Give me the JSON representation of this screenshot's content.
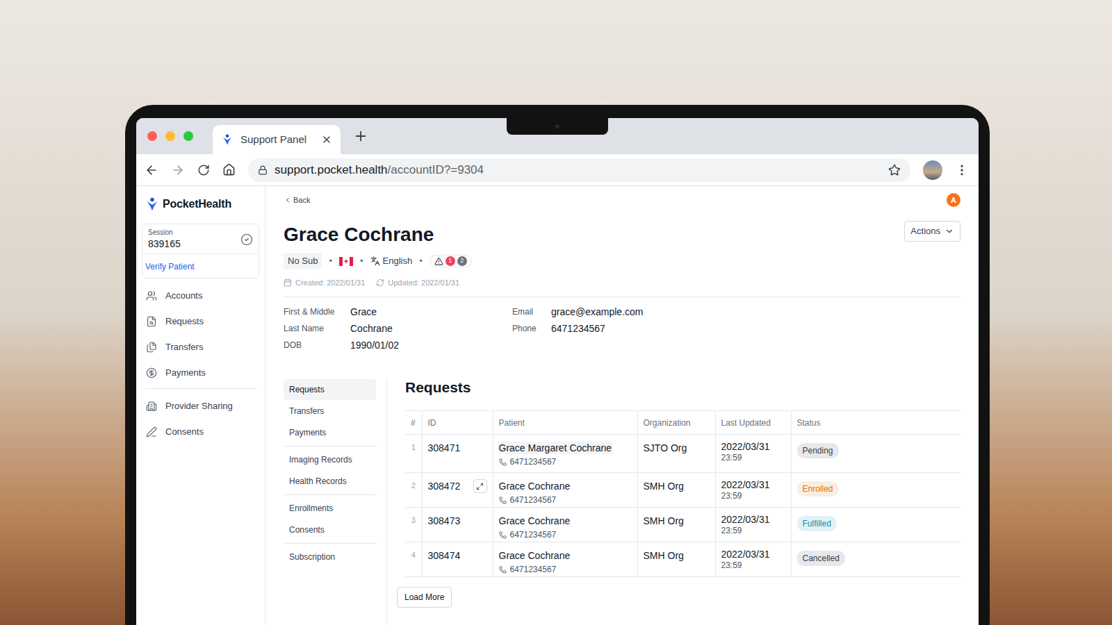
{
  "browser": {
    "tab_title": "Support Panel",
    "url_host": "support.pocket.health",
    "url_path": "/accountID?=9304"
  },
  "app": {
    "logo": "PocketHealth"
  },
  "session": {
    "label": "Session",
    "number": "839165",
    "verified": true,
    "action": "Verify Patient"
  },
  "sidebar": {
    "groups": [
      [
        {
          "label": "Accounts",
          "icon": "accounts",
          "selected": false
        },
        {
          "label": "Requests",
          "icon": "requests",
          "selected": false
        },
        {
          "label": "Transfers",
          "icon": "transfers",
          "selected": false
        },
        {
          "label": "Payments",
          "icon": "payments",
          "selected": false
        }
      ],
      [
        {
          "label": "Provider Sharing",
          "icon": "provider",
          "selected": false
        },
        {
          "label": "Consents",
          "icon": "consents",
          "selected": false
        }
      ]
    ]
  },
  "header": {
    "back": "Back",
    "avatar": "A",
    "name": "Grace Cochrane",
    "actions": "Actions",
    "subscription": "No Sub",
    "language": "English",
    "alerts": [
      {
        "count": "1",
        "color": "#f43f5e"
      },
      {
        "count": "2",
        "color": "#6b7280"
      }
    ],
    "created": "Created: 2022/01/31",
    "updated": "Updated: 2022/01/31"
  },
  "fields": {
    "left": [
      {
        "label": "First & Middle",
        "value": "Grace"
      },
      {
        "label": "Last Name",
        "value": "Cochrane"
      },
      {
        "label": "DOB",
        "value": "1990/01/02"
      }
    ],
    "right": [
      {
        "label": "Email",
        "value": "grace@example.com"
      },
      {
        "label": "Phone",
        "value": "6471234567"
      }
    ]
  },
  "subnav": {
    "groups": [
      [
        {
          "label": "Requests",
          "selected": true
        },
        {
          "label": "Transfers",
          "selected": false
        },
        {
          "label": "Payments",
          "selected": false
        }
      ],
      [
        {
          "label": "Imaging Records",
          "selected": false
        },
        {
          "label": "Health Records",
          "selected": false
        }
      ],
      [
        {
          "label": "Enrollments",
          "selected": false
        },
        {
          "label": "Consents",
          "selected": false
        }
      ],
      [
        {
          "label": "Subscription",
          "selected": false
        }
      ]
    ]
  },
  "requests": {
    "title": "Requests",
    "columns": [
      "#",
      "ID",
      "Patient",
      "Organization",
      "Last Updated",
      "Status"
    ],
    "rows": [
      {
        "index": "1",
        "id": "308471",
        "patient": "Grace Margaret Cochrane",
        "phone": "6471234567",
        "organization": "SJTO Org",
        "date": "2022/03/31",
        "time": "23:59",
        "status": "Pending",
        "color": "#374151",
        "highlighted": true,
        "expand_icon": false
      },
      {
        "index": "2",
        "id": "308472",
        "patient": "Grace Cochrane",
        "phone": "6471234567",
        "organization": "SMH Org",
        "date": "2022/03/31",
        "time": "23:59",
        "status": "Enrolled",
        "color": "#d97706",
        "highlighted": false,
        "expand_icon": true
      },
      {
        "index": "3",
        "id": "308473",
        "patient": "Grace Cochrane",
        "phone": "6471234567",
        "organization": "SMH Org",
        "date": "2022/03/31",
        "time": "23:59",
        "status": "Fulfilled",
        "color": "#0891b2",
        "highlighted": false,
        "expand_icon": false
      },
      {
        "index": "4",
        "id": "308474",
        "patient": "Grace Cochrane",
        "phone": "6471234567",
        "organization": "SMH Org",
        "date": "2022/03/31",
        "time": "23:59",
        "status": "Cancelled",
        "color": "#374151",
        "highlighted": false,
        "expand_icon": false
      }
    ]
  },
  "load_more": "Load More"
}
